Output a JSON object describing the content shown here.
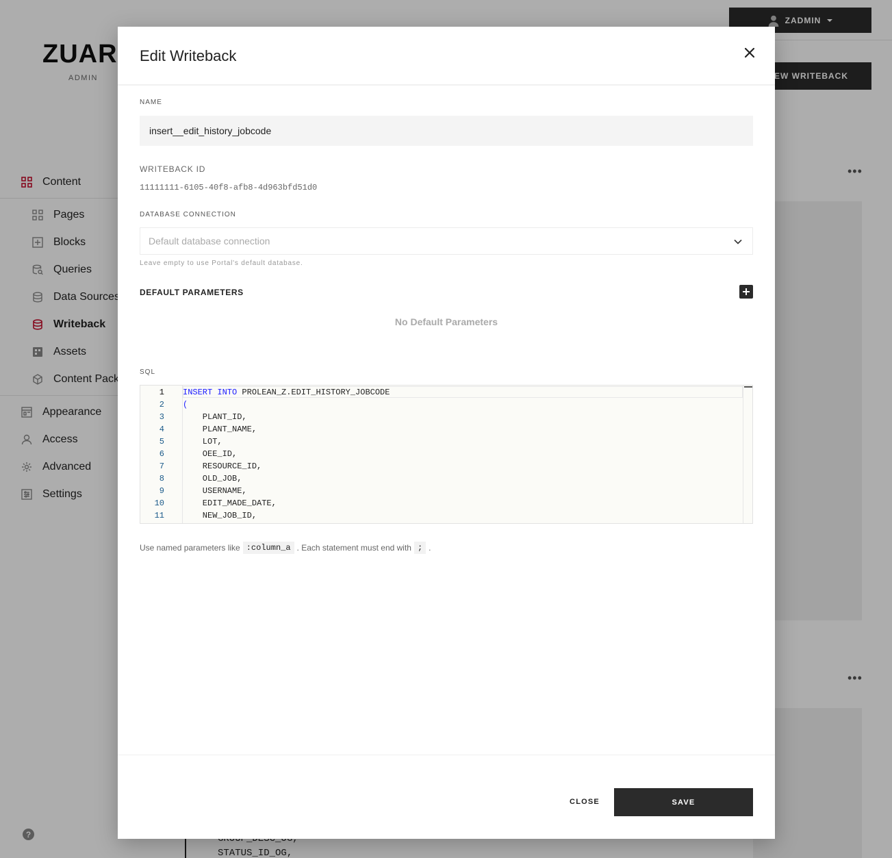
{
  "app": {
    "logo": "ZUAR",
    "logo_sub": "ADMIN",
    "user": "ZADMIN",
    "new_button": "NEW WRITEBACK",
    "help": "?"
  },
  "sidebar": {
    "content": "Content",
    "items": [
      {
        "label": "Pages",
        "icon": "grid-icon"
      },
      {
        "label": "Blocks",
        "icon": "plus-square-icon"
      },
      {
        "label": "Queries",
        "icon": "database-search-icon"
      },
      {
        "label": "Data Sources",
        "icon": "database-icon"
      },
      {
        "label": "Writeback",
        "icon": "database-icon"
      },
      {
        "label": "Assets",
        "icon": "assets-icon"
      },
      {
        "label": "Content Pack",
        "icon": "package-icon"
      }
    ],
    "bottom": [
      {
        "label": "Appearance",
        "icon": "appearance-icon"
      },
      {
        "label": "Access",
        "icon": "user-icon"
      },
      {
        "label": "Advanced",
        "icon": "gear-icon"
      },
      {
        "label": "Settings",
        "icon": "sliders-icon"
      }
    ]
  },
  "background_code": [
    "GROUP_DESC_OG,",
    "STATUS_ID_OG,"
  ],
  "modal": {
    "title": "Edit Writeback",
    "name_label": "NAME",
    "name_value": "insert__edit_history_jobcode",
    "id_label": "WRITEBACK ID",
    "id_value": "11111111-6105-40f8-afb8-4d963bfd51d0",
    "db_label": "DATABASE CONNECTION",
    "db_placeholder": "Default database connection",
    "db_hint": "Leave empty to use Portal's default database.",
    "params_title": "DEFAULT PARAMETERS",
    "no_params": "No Default Parameters",
    "sql_label": "SQL",
    "sql_lines": [
      {
        "n": "1",
        "kw": "INSERT INTO",
        "text": " PROLEAN_Z.EDIT_HISTORY_JOBCODE"
      },
      {
        "n": "2",
        "kw": "(",
        "text": ""
      },
      {
        "n": "3",
        "kw": "",
        "text": "    PLANT_ID,"
      },
      {
        "n": "4",
        "kw": "",
        "text": "    PLANT_NAME,"
      },
      {
        "n": "5",
        "kw": "",
        "text": "    LOT,"
      },
      {
        "n": "6",
        "kw": "",
        "text": "    OEE_ID,"
      },
      {
        "n": "7",
        "kw": "",
        "text": "    RESOURCE_ID,"
      },
      {
        "n": "8",
        "kw": "",
        "text": "    OLD_JOB,"
      },
      {
        "n": "9",
        "kw": "",
        "text": "    USERNAME,"
      },
      {
        "n": "10",
        "kw": "",
        "text": "    EDIT_MADE_DATE,"
      },
      {
        "n": "11",
        "kw": "",
        "text": "    NEW_JOB_ID,"
      }
    ],
    "footnote_pre": "Use named parameters like",
    "footnote_code1": ":column_a",
    "footnote_mid": ". Each statement must end with",
    "footnote_code2": ";",
    "footnote_post": ".",
    "close_label": "CLOSE",
    "save_label": "SAVE"
  },
  "colors": {
    "accent": "#c8102e",
    "dark": "#2b2b2b"
  }
}
